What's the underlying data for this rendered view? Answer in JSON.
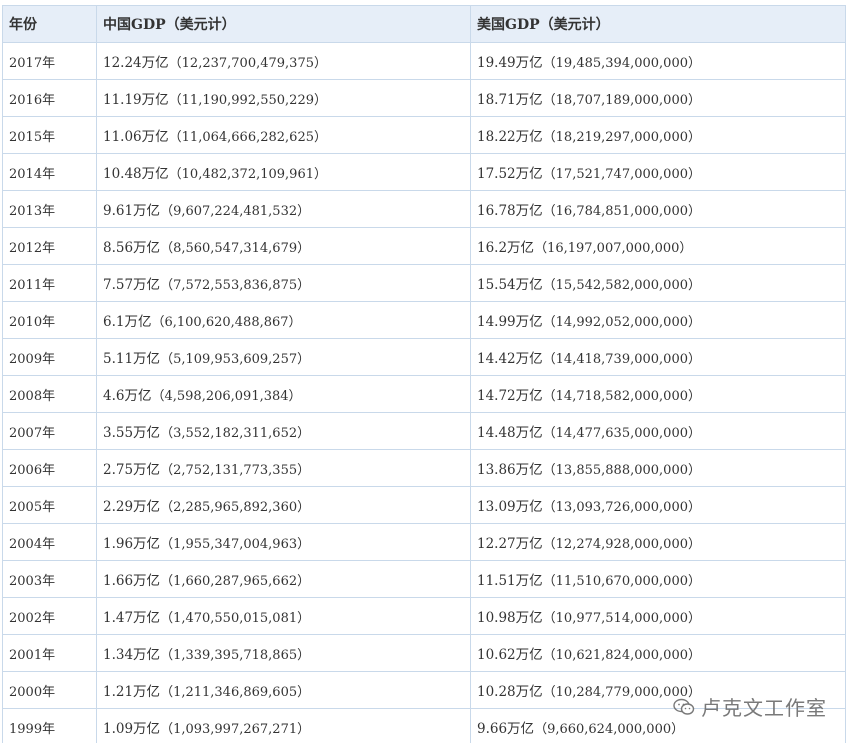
{
  "table": {
    "headers": {
      "year": "年份",
      "china": "中国GDP（美元计）",
      "usa": "美国GDP（美元计）"
    },
    "rows": [
      {
        "year": "2017年",
        "cn_short": "12.24万亿",
        "cn_full": "（12,237,700,479,375）",
        "us_short": "19.49万亿",
        "us_full": "（19,485,394,000,000）"
      },
      {
        "year": "2016年",
        "cn_short": "11.19万亿",
        "cn_full": "（11,190,992,550,229）",
        "us_short": "18.71万亿",
        "us_full": "（18,707,189,000,000）"
      },
      {
        "year": "2015年",
        "cn_short": "11.06万亿",
        "cn_full": "（11,064,666,282,625）",
        "us_short": "18.22万亿",
        "us_full": "（18,219,297,000,000）"
      },
      {
        "year": "2014年",
        "cn_short": "10.48万亿",
        "cn_full": "（10,482,372,109,961）",
        "us_short": "17.52万亿",
        "us_full": "（17,521,747,000,000）"
      },
      {
        "year": "2013年",
        "cn_short": "9.61万亿",
        "cn_full": "（9,607,224,481,532）",
        "us_short": "16.78万亿",
        "us_full": "（16,784,851,000,000）"
      },
      {
        "year": "2012年",
        "cn_short": "8.56万亿",
        "cn_full": "（8,560,547,314,679）",
        "us_short": "16.2万亿",
        "us_full": "（16,197,007,000,000）"
      },
      {
        "year": "2011年",
        "cn_short": "7.57万亿",
        "cn_full": "（7,572,553,836,875）",
        "us_short": "15.54万亿",
        "us_full": "（15,542,582,000,000）"
      },
      {
        "year": "2010年",
        "cn_short": "6.1万亿",
        "cn_full": "（6,100,620,488,867）",
        "us_short": "14.99万亿",
        "us_full": "（14,992,052,000,000）"
      },
      {
        "year": "2009年",
        "cn_short": "5.11万亿",
        "cn_full": "（5,109,953,609,257）",
        "us_short": "14.42万亿",
        "us_full": "（14,418,739,000,000）"
      },
      {
        "year": "2008年",
        "cn_short": "4.6万亿",
        "cn_full": "（4,598,206,091,384）",
        "us_short": "14.72万亿",
        "us_full": "（14,718,582,000,000）"
      },
      {
        "year": "2007年",
        "cn_short": "3.55万亿",
        "cn_full": "（3,552,182,311,652）",
        "us_short": "14.48万亿",
        "us_full": "（14,477,635,000,000）"
      },
      {
        "year": "2006年",
        "cn_short": "2.75万亿",
        "cn_full": "（2,752,131,773,355）",
        "us_short": "13.86万亿",
        "us_full": "（13,855,888,000,000）"
      },
      {
        "year": "2005年",
        "cn_short": "2.29万亿",
        "cn_full": "（2,285,965,892,360）",
        "us_short": "13.09万亿",
        "us_full": "（13,093,726,000,000）"
      },
      {
        "year": "2004年",
        "cn_short": "1.96万亿",
        "cn_full": "（1,955,347,004,963）",
        "us_short": "12.27万亿",
        "us_full": "（12,274,928,000,000）"
      },
      {
        "year": "2003年",
        "cn_short": "1.66万亿",
        "cn_full": "（1,660,287,965,662）",
        "us_short": "11.51万亿",
        "us_full": "（11,510,670,000,000）"
      },
      {
        "year": "2002年",
        "cn_short": "1.47万亿",
        "cn_full": "（1,470,550,015,081）",
        "us_short": "10.98万亿",
        "us_full": "（10,977,514,000,000）"
      },
      {
        "year": "2001年",
        "cn_short": "1.34万亿",
        "cn_full": "（1,339,395,718,865）",
        "us_short": "10.62万亿",
        "us_full": "（10,621,824,000,000）"
      },
      {
        "year": "2000年",
        "cn_short": "1.21万亿",
        "cn_full": "（1,211,346,869,605）",
        "us_short": "10.28万亿",
        "us_full": "（10,284,779,000,000）"
      },
      {
        "year": "1999年",
        "cn_short": "1.09万亿",
        "cn_full": "（1,093,997,267,271）",
        "us_short": "9.66万亿",
        "us_full": "（9,660,624,000,000）"
      }
    ]
  },
  "watermark": {
    "text": "卢克文工作室",
    "icon": "wechat-icon"
  },
  "colors": {
    "header_bg": "#e6eef8",
    "border": "#c9d9ea",
    "text": "#333333"
  }
}
